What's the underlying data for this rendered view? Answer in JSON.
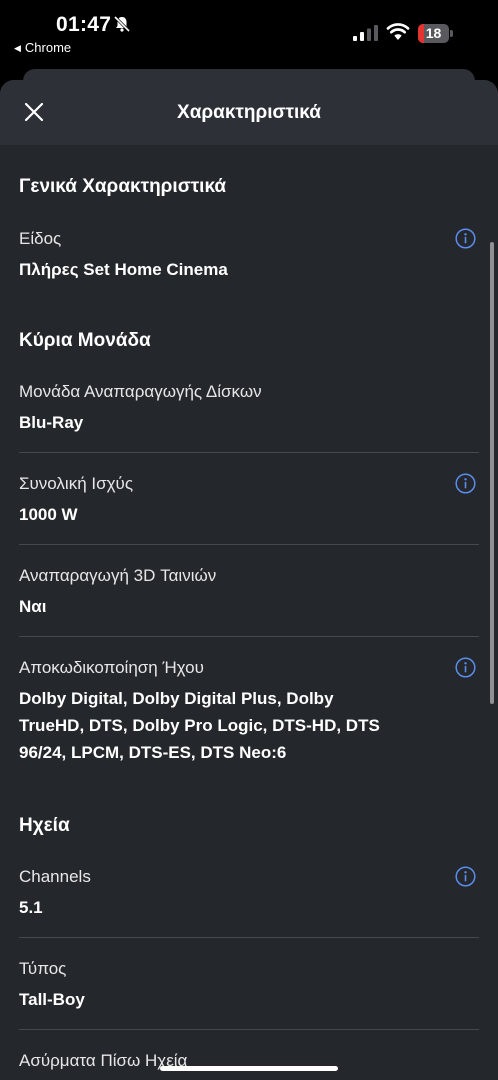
{
  "status_bar": {
    "time": "01:47",
    "back_app": "Chrome",
    "battery_level": "18",
    "battery_fraction": 0.18,
    "battery_color": "#e5342f"
  },
  "sheet": {
    "title": "Χαρακτηριστικά"
  },
  "sections": [
    {
      "title": "Γενικά Χαρακτηριστικά",
      "rows": [
        {
          "label": "Είδος",
          "value": "Πλήρες Set Home Cinema",
          "info": true
        }
      ]
    },
    {
      "title": "Κύρια Μονάδα",
      "rows": [
        {
          "label": "Μονάδα Αναπαραγωγής Δίσκων",
          "value": "Blu-Ray",
          "info": false
        },
        {
          "label": "Συνολική Ισχύς",
          "value": "1000 W",
          "info": true
        },
        {
          "label": "Αναπαραγωγή 3D Ταινιών",
          "value": "Ναι",
          "info": false
        },
        {
          "label": "Αποκωδικοποίηση Ήχου",
          "value_lines": [
            "Dolby Digital, Dolby Digital Plus, Dolby",
            "TrueHD, DTS, Dolby Pro Logic, DTS-HD, DTS",
            "96/24, LPCM, DTS-ES, DTS Neo:6"
          ],
          "info": true
        }
      ]
    },
    {
      "title": "Ηχεία",
      "rows": [
        {
          "label": "Channels",
          "value": "5.1",
          "info": true
        },
        {
          "label": "Τύπος",
          "value": "Tall-Boy",
          "info": false
        },
        {
          "label": "Ασύρματα Πίσω Ηχεία",
          "info": false
        }
      ]
    }
  ],
  "colors": {
    "sheet_bg": "#24272b",
    "header_bg": "#2d3137",
    "info_icon": "#5b8def"
  }
}
